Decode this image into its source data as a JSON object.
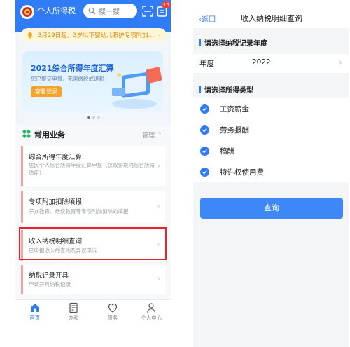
{
  "left": {
    "app_title": "个人所得税",
    "search_placeholder": "搜一搜",
    "message_badge": "15",
    "notice": "3月29日起，3岁以下婴幼儿照护专项附加…",
    "banner": {
      "title": "2021综合所得年度汇算",
      "subtitle": "您已提交申报，无需缴税或退税",
      "button": "查看记录"
    },
    "section": {
      "title": "常用业务",
      "manage": "管理"
    },
    "cards": [
      {
        "title": "综合所得年度汇算",
        "desc": "居民个人综合所得年度汇算申报（仅取得境内综合所得适用）"
      },
      {
        "title": "专项附加扣除填报",
        "desc": "子女教育、继续教育等专项附加扣除的填报"
      },
      {
        "title": "收入纳税明细查询",
        "desc": "已申报收入的查询及异议申诉"
      },
      {
        "title": "纳税记录开具",
        "desc": "申请开具纳税记录"
      }
    ],
    "tabs": [
      {
        "label": "首页",
        "icon": "home-icon",
        "active": true
      },
      {
        "label": "办税",
        "icon": "document-icon",
        "active": false
      },
      {
        "label": "服务",
        "icon": "service-icon",
        "active": false
      },
      {
        "label": "个人中心",
        "icon": "user-icon",
        "active": false
      }
    ]
  },
  "right": {
    "back": "返回",
    "title": "收入纳税明细查询",
    "year_section": "请选择纳税记录年度",
    "year_label": "年度",
    "year_value": "2022",
    "type_section": "请选择所得类型",
    "types": [
      "工资薪金",
      "劳务报酬",
      "稿酬",
      "特许权使用费"
    ],
    "query_button": "查询"
  },
  "colors": {
    "primary": "#2f7cf6",
    "highlight": "#e8232a",
    "notice_text": "#d98a10",
    "banner_button": "#f7a32b"
  }
}
